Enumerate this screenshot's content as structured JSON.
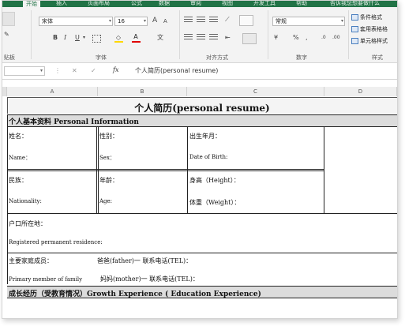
{
  "ribbon": {
    "tabs": [
      "开始",
      "插入",
      "页面布局",
      "公式",
      "数据",
      "审阅",
      "视图",
      "开发工具",
      "帮助",
      "告诉我您想要做什么"
    ],
    "active_tab": "开始",
    "font_name": "宋体",
    "font_size": "16",
    "number_format": "常规",
    "group_labels": {
      "clipboard": "贴板",
      "font": "字体",
      "alignment": "对齐方式",
      "number": "数字",
      "styles": "样式"
    },
    "bold": "B",
    "italic": "I",
    "underline": "U",
    "font_grow": "A",
    "font_shrink": "A",
    "number_buttons": [
      "%",
      ","
    ],
    "style_buttons": [
      "条件格式",
      "套用表格格",
      "单元格样式"
    ]
  },
  "formula_bar": {
    "fx": "fx",
    "content": "个人简历(personal resume)"
  },
  "columns": [
    "A",
    "B",
    "C",
    "D"
  ],
  "sheet": {
    "title": "个人简历(personal resume)",
    "section1": "个人基本资料  Personal  Information",
    "name_cn": "姓名：",
    "name_en": "Name：",
    "sex_cn": "性别：",
    "sex_en": "Sex：",
    "dob_cn": "出生年月：",
    "dob_en": "Date of Birth:",
    "nation_cn": "民族：",
    "nation_en": "Nationality:",
    "age_cn": "年龄：",
    "age_en": "Age:",
    "height": "身高（Height）：",
    "weight": "体重（Weight）：",
    "residence_cn": "户口所在地：",
    "residence_en": "Registered permanent residence:",
    "family_cn": "主要家庭成员：",
    "father": "爸爸(father)一   联系电话(TEL)：",
    "family_en": "Primary member of family",
    "mother": "妈妈(mother)一   联系电话(TEL)：",
    "section2": "成长经历（受教育情况）Growth Experience ( Education Experience)"
  }
}
